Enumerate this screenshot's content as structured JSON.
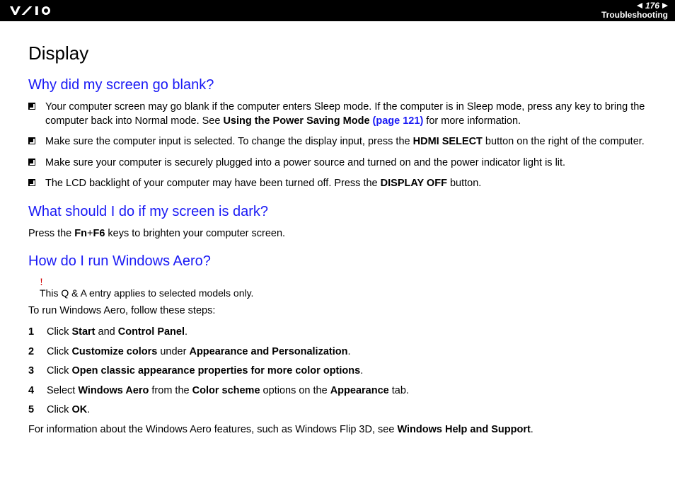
{
  "header": {
    "page_number": "176",
    "section": "Troubleshooting"
  },
  "title": "Display",
  "q1": {
    "heading": "Why did my screen go blank?",
    "b1_a": "Your computer screen may go blank if the computer enters Sleep mode. If the computer is in Sleep mode, press any key to bring the computer back into Normal mode. See ",
    "b1_b": "Using the Power Saving Mode ",
    "b1_c": "(page 121)",
    "b1_d": " for more information.",
    "b2_a": "Make sure the computer input is selected. To change the display input, press the ",
    "b2_b": "HDMI SELECT",
    "b2_c": " button on the right of the computer.",
    "b3": "Make sure your computer is securely plugged into a power source and turned on and the power indicator light is lit.",
    "b4_a": "The LCD backlight of your computer may have been turned off. Press the ",
    "b4_b": "DISPLAY OFF",
    "b4_c": " button."
  },
  "q2": {
    "heading": "What should I do if my screen is dark?",
    "p_a": "Press the ",
    "p_b": "Fn",
    "p_c": "+",
    "p_d": "F6",
    "p_e": " keys to brighten your computer screen."
  },
  "q3": {
    "heading": "How do I run Windows Aero?",
    "excl": "!",
    "note": "This Q & A entry applies to selected models only.",
    "intro": "To run Windows Aero, follow these steps:",
    "s1_n": "1",
    "s1_a": "Click ",
    "s1_b": "Start",
    "s1_c": " and ",
    "s1_d": "Control Panel",
    "s1_e": ".",
    "s2_n": "2",
    "s2_a": "Click ",
    "s2_b": "Customize colors",
    "s2_c": " under ",
    "s2_d": "Appearance and Personalization",
    "s2_e": ".",
    "s3_n": "3",
    "s3_a": "Click ",
    "s3_b": "Open classic appearance properties for more color options",
    "s3_c": ".",
    "s4_n": "4",
    "s4_a": "Select ",
    "s4_b": "Windows Aero",
    "s4_c": " from the ",
    "s4_d": "Color scheme",
    "s4_e": " options on the ",
    "s4_f": "Appearance",
    "s4_g": " tab.",
    "s5_n": "5",
    "s5_a": "Click ",
    "s5_b": "OK",
    "s5_c": ".",
    "outro_a": "For information about the Windows Aero features, such as Windows Flip 3D, see ",
    "outro_b": "Windows Help and Support",
    "outro_c": "."
  }
}
